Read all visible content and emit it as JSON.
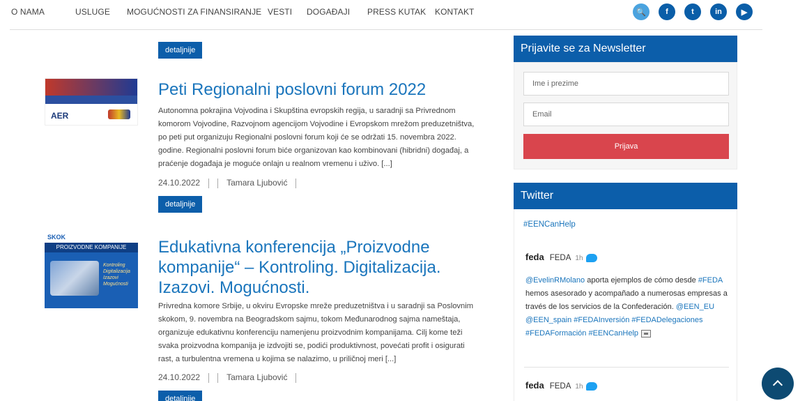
{
  "nav": {
    "items": [
      "O NAMA",
      "USLUGE",
      "MOGUĆNOSTI ZA FINANSIRANJE",
      "VESTI",
      "DOGAĐAJI",
      "PRESS KUTAK",
      "KONTAKT"
    ],
    "social": [
      "search-icon",
      "facebook-icon",
      "twitter-icon",
      "linkedin-icon",
      "youtube-icon"
    ],
    "social_glyphs": [
      "🔍",
      "f",
      "t",
      "in",
      "▶"
    ]
  },
  "articles": [
    {
      "detail_label": "detaljnije"
    },
    {
      "title": "Peti Regionalni poslovni forum 2022",
      "body": "Autonomna pokrajina Vojvodina i Skupština evropskih regija, u saradnji sa Privrednom komorom Vojvodine, Razvojnom agencijom Vojvodine i Evropskom mrežom preduzetništva, po peti put organizuju Regionalni poslovni forum koji će se održati 15. novembra 2022. godine. Regionalni poslovni forum biće organizovan kao kombinovani (hibridni) događaj, a praćenje događaja je moguće onlajn u realnom vremenu i uživo. [...]",
      "date": "24.10.2022",
      "author": "Tamara Ljubović",
      "detail_label": "detaljnije",
      "thumb_text": "AER"
    },
    {
      "title": "Edukativna konferencija „Proizvodne kompanije“ – Kontroling. Digitalizacija. Izazovi. Mogućnosti.",
      "body": "Privredna komore Srbije, u okviru Evropske mreže preduzetništva i u saradnji sa Poslovnim skokom, 9. novembra na Beogradskom sajmu, tokom Međunarodnog sajma nameštaja, organizuje edukativnu konferenciju namenjenu proizvodnim kompanijama. Cilj kome teži svaka proizvodna kompanija je izdvojiti se, podići produktivnost, povećati profit i osigurati rast, a turbulentna vremena u kojima se nalazimo, u priličnoj meri [...]",
      "date": "24.10.2022",
      "author": "Tamara Ljubović",
      "detail_label": "detaljnije",
      "thumb_brand": "SKOK",
      "thumb_heading": "PROIZVODNE KOMPANIJE",
      "thumb_tag": "Kontroling Digitalizacija Izazovi Mogućnosti"
    }
  ],
  "newsletter": {
    "title": "Prijavite se za Newsletter",
    "name_placeholder": "Ime i prezime",
    "email_placeholder": "Email",
    "submit_label": "Prijava"
  },
  "twitter": {
    "title": "Twitter",
    "hashtag": "#EENCanHelp",
    "tweets": [
      {
        "logo": "feda",
        "name": "FEDA",
        "time": "1h",
        "mention": "@EvelinRMolano",
        "text_1": " aporta ejemplos de cómo desde ",
        "tag_1": "#FEDA",
        "text_2": " hemos asesorado y acompañado a numerosas empresas a través de los servicios de la Confederación. ",
        "links": "@EEN_EU @EEN_spain #FEDAInversión #FEDADelegaciones #FEDAFormación #EENCanHelp"
      },
      {
        "logo": "feda",
        "name": "FEDA",
        "time": "1h"
      }
    ]
  },
  "colors": {
    "brand_blue": "#0c5eaa",
    "link_blue": "#1a75bc",
    "submit_red": "#d9454d",
    "scroll_top": "#0d4a72"
  }
}
